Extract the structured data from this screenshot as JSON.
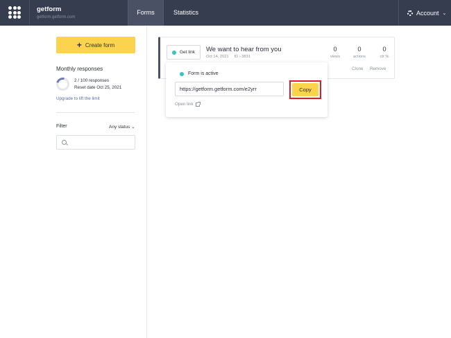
{
  "header": {
    "brand_name": "getform",
    "brand_subtitle": "getform.getform.com",
    "nav": [
      {
        "label": "Forms"
      },
      {
        "label": "Statistics"
      }
    ],
    "account_label": "Account"
  },
  "sidebar": {
    "create_form_label": "Create form",
    "monthly_title": "Monthly responses",
    "responses_text": "2 / 100 responses",
    "reset_text": "Reset date Oct 25, 2021",
    "usage_fraction": 0.02,
    "upgrade_link": "Upgrade to lift the limit",
    "filter_label": "Filter",
    "status_select": "Any status",
    "search_placeholder": ""
  },
  "form_card": {
    "get_link_label": "Get link",
    "title": "We want to hear from you",
    "date": "Oct 14, 2021",
    "id_text": "ID - 3831",
    "stats": [
      {
        "value": "0",
        "label": "views"
      },
      {
        "value": "0",
        "label": "actions"
      },
      {
        "value": "0",
        "label": "ctr %"
      }
    ],
    "clone_label": "Clone",
    "remove_label": "Remove"
  },
  "popover": {
    "status_text": "Form is active",
    "url": "https://getform.getform.com/e2yrr",
    "copy_label": "Copy",
    "open_link_label": "Open link"
  },
  "colors": {
    "topbar": "#363d4f",
    "accent_yellow": "#fcd34d",
    "active_dot": "#38c1c7",
    "highlight_red": "#d81e2a"
  }
}
